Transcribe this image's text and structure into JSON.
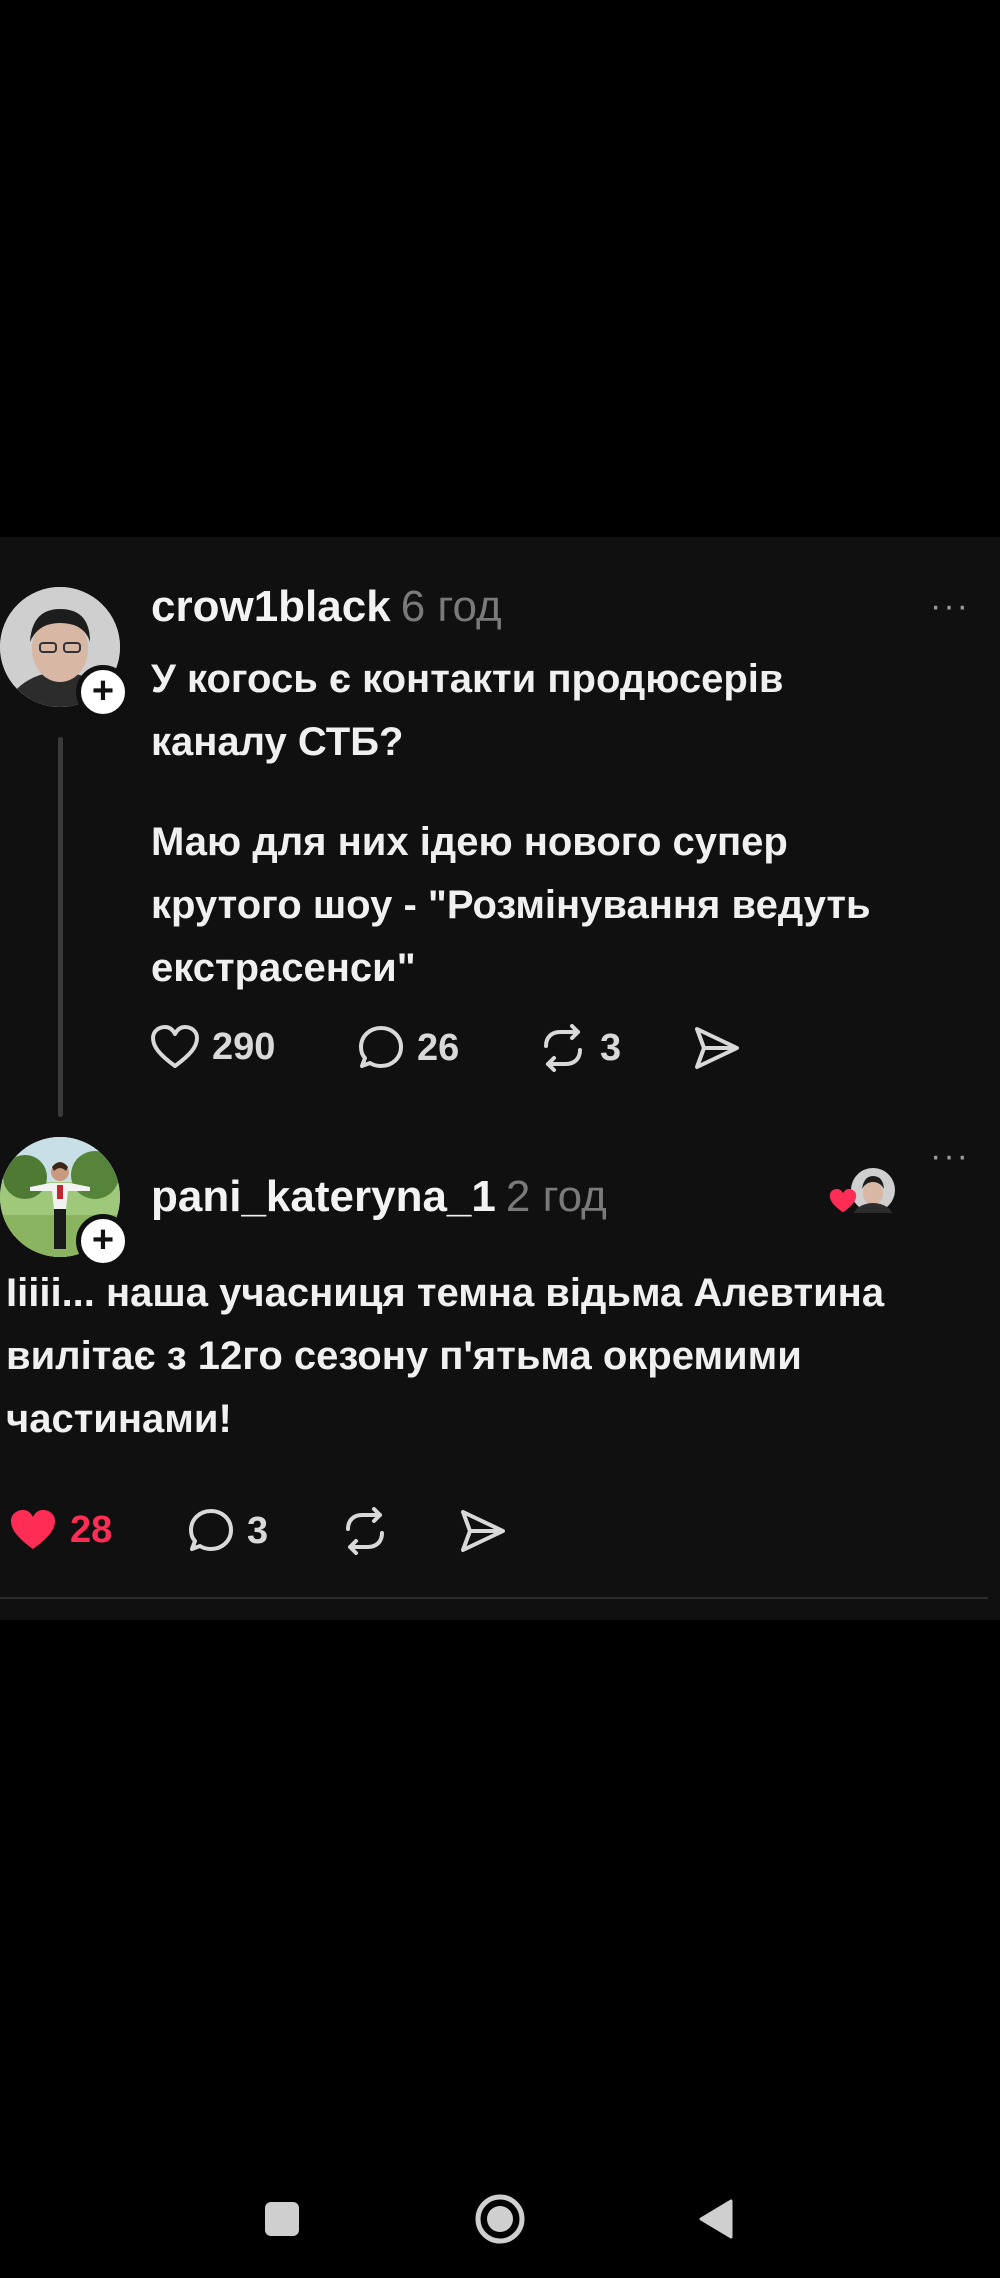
{
  "post": {
    "username": "crow1black",
    "time": "6 год",
    "more_label": "···",
    "text_p1": "У когось є контакти продюсерів каналу СТБ?",
    "text_p2": "Маю для них ідею нового супер крутого шоу - \"Розмінування ведуть екстрасенси\"",
    "likes": "290",
    "comments": "26",
    "reposts": "3"
  },
  "reply": {
    "username": "pani_kateryna_1",
    "time": "2 год",
    "more_label": "···",
    "text": "Iiiii... наша учасниця темна відьма Алевтина вилітає з 12го сезону п'ятьма окремими частинами!",
    "likes": "28",
    "comments": "3",
    "liked": true
  },
  "colors": {
    "background": "#000000",
    "card": "#101010",
    "like_active": "#ff2d55"
  },
  "icons": [
    "heart-icon",
    "comment-icon",
    "repost-icon",
    "share-icon",
    "plus-icon",
    "more-icon"
  ]
}
